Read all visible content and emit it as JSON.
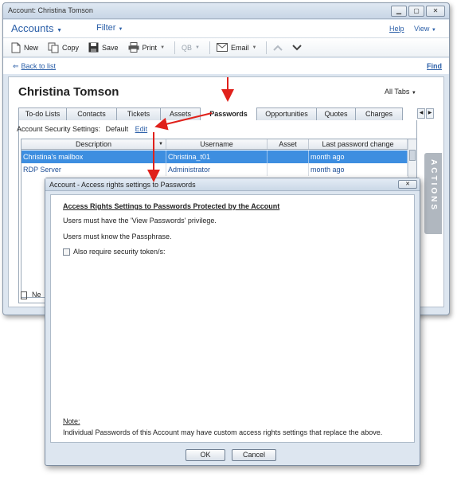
{
  "window": {
    "title": "Account:  Christina Tomson",
    "minimize": "▁",
    "restore": "▢",
    "close": "✕"
  },
  "menubar": {
    "accounts": "Accounts",
    "filter": "Filter",
    "help": "Help",
    "view": "View"
  },
  "toolbar": {
    "new": "New",
    "copy": "Copy",
    "save": "Save",
    "print": "Print",
    "qb": "QB",
    "email": "Email"
  },
  "links": {
    "back": "Back to list",
    "find": "Find"
  },
  "record": {
    "name": "Christina Tomson",
    "all_tabs": "All Tabs"
  },
  "tabs": [
    "To-do Lists",
    "Contacts",
    "Tickets",
    "Assets",
    "Passwords",
    "Opportunities",
    "Quotes",
    "Charges"
  ],
  "security": {
    "label": "Account Security Settings:",
    "value": "Default",
    "edit": "Edit"
  },
  "grid": {
    "columns": [
      "Description",
      "Username",
      "Asset",
      "Last password change"
    ],
    "rows": [
      {
        "description": "Christina's mailbox",
        "username": "Christina_t01",
        "asset": "",
        "last_change": "month ago",
        "selected": true
      },
      {
        "description": "RDP Server",
        "username": "Administrator",
        "asset": "",
        "last_change": "month ago",
        "selected": false
      }
    ]
  },
  "new_label": "Ne",
  "actions_label": "ACTIONS",
  "dialog": {
    "title": "Account - Access rights settings to Passwords",
    "heading": "Access Rights Settings to Passwords Protected by the Account",
    "line1": "Users must have the 'View Passwords' privilege.",
    "line2": "Users must know the Passphrase.",
    "checkbox": "Also require security token/s:",
    "note_label": "Note:",
    "note_text": "Individual Passwords of this Account may have custom access rights settings that replace the above.",
    "ok": "OK",
    "cancel": "Cancel",
    "close": "✕"
  },
  "colors": {
    "accent": "#2b5fa8",
    "selection": "#3d8ee0",
    "arrow": "#e0211b"
  }
}
